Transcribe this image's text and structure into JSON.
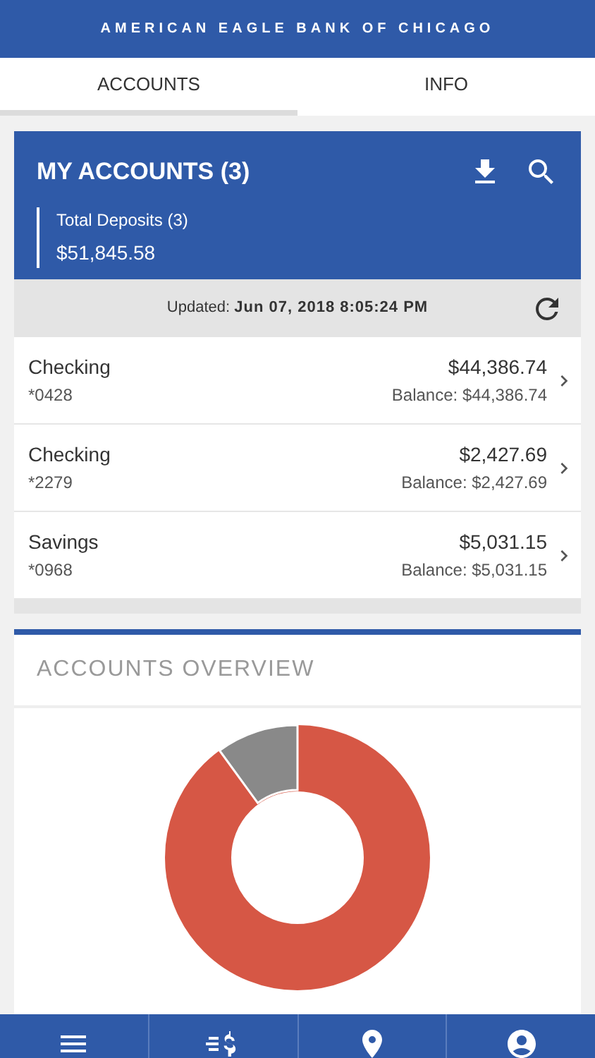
{
  "header": {
    "title": "AMERICAN EAGLE BANK OF CHICAGO"
  },
  "tabs": [
    {
      "label": "ACCOUNTS",
      "selected": true
    },
    {
      "label": "INFO",
      "selected": false
    }
  ],
  "accounts_card": {
    "title": "MY ACCOUNTS (3)",
    "total_label": "Total Deposits (3)",
    "total_value": "$51,845.58",
    "updated_label": "Updated:",
    "updated_value": "Jun 07, 2018 8:05:24 PM"
  },
  "accounts": [
    {
      "name": "Checking",
      "number": "*0428",
      "amount": "$44,386.74",
      "balance": "Balance: $44,386.74"
    },
    {
      "name": "Checking",
      "number": "*2279",
      "amount": "$2,427.69",
      "balance": "Balance: $2,427.69"
    },
    {
      "name": "Savings",
      "number": "*0968",
      "amount": "$5,031.15",
      "balance": "Balance: $5,031.15"
    }
  ],
  "overview": {
    "title": "ACCOUNTS OVERVIEW"
  }
}
